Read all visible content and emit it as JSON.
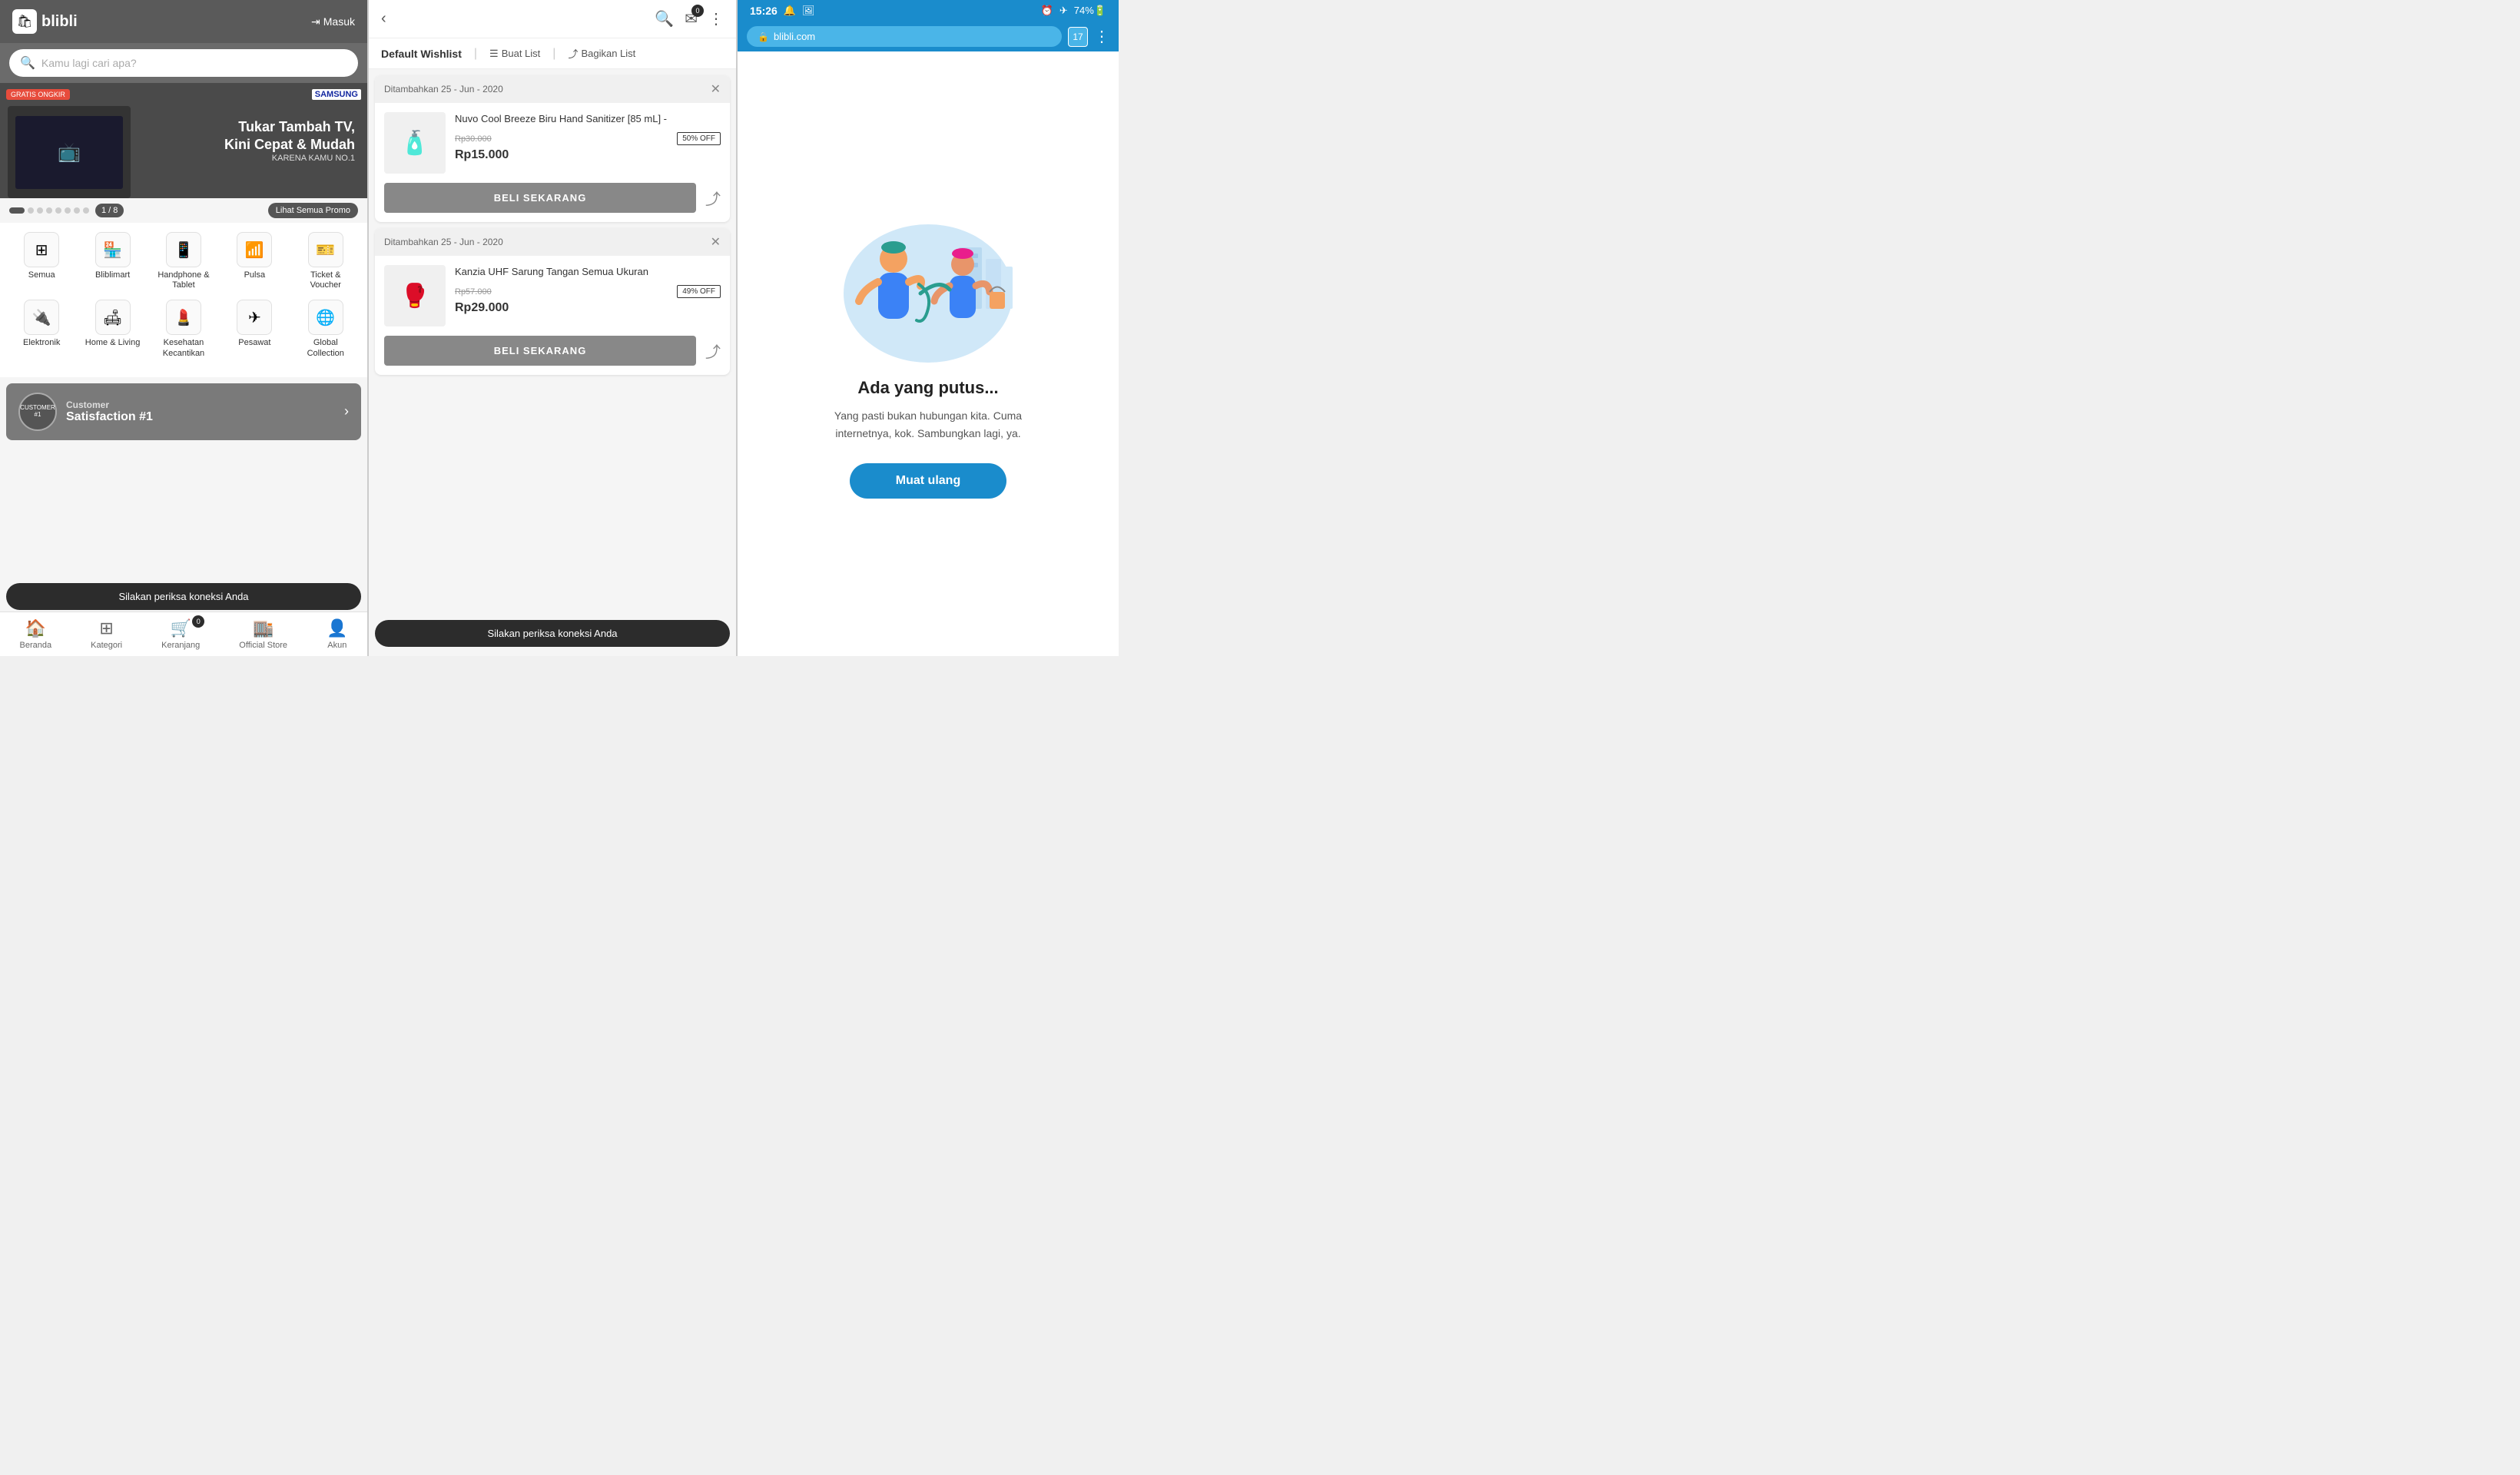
{
  "panel1": {
    "logo": "blibli",
    "logo_icon": "🛍",
    "masuk_label": "Masuk",
    "search_placeholder": "Kamu lagi cari apa?",
    "banner": {
      "gratis_label": "GRATIS ONGKIR",
      "title_line1": "Tukar Tambah TV,",
      "title_line2": "Kini Cepat & Mudah",
      "sub": "KARENA KAMU NO.1",
      "brand": "SAMSUNG"
    },
    "page_indicator": "1 / 8",
    "promo_btn": "Lihat Semua Promo",
    "categories": [
      {
        "icon": "⊞",
        "label": "Semua"
      },
      {
        "icon": "🏪",
        "label": "Bliblimart"
      },
      {
        "icon": "📱",
        "label": "Handphone & Tablet"
      },
      {
        "icon": "📶",
        "label": "Pulsa"
      },
      {
        "icon": "🎫",
        "label": "Ticket & Voucher"
      },
      {
        "icon": "🔌",
        "label": "Elektronik"
      },
      {
        "icon": "🛋",
        "label": "Home & Living"
      },
      {
        "icon": "💄",
        "label": "Kesehatan Kecantikan"
      },
      {
        "icon": "✈",
        "label": "Pesawat"
      },
      {
        "icon": "🌐",
        "label": "Global Collection"
      }
    ],
    "satisfaction": {
      "badge": "CUSTOMER SATISFACTION #1",
      "label": "Customer",
      "title": "Satisfaction #1"
    },
    "offline_msg": "Silakan periksa koneksi Anda",
    "footer": [
      {
        "icon": "🏠",
        "label": "Beranda"
      },
      {
        "icon": "⊞",
        "label": "Kategori"
      },
      {
        "icon": "🛒",
        "label": "Keranjang",
        "badge": "0"
      },
      {
        "icon": "🏬",
        "label": "Official Store"
      },
      {
        "icon": "👤",
        "label": "Akun"
      }
    ]
  },
  "panel2": {
    "back_icon": "‹",
    "search_icon": "🔍",
    "cart_icon": "✉",
    "cart_badge": "0",
    "more_icon": "⋮",
    "wishlist_title": "Default Wishlist",
    "buat_list": "Buat List",
    "bagikan_list": "Bagikan List",
    "items": [
      {
        "date": "Ditambahkan 25 - Jun - 2020",
        "name": "Nuvo Cool Breeze Biru Hand Sanitizer [85 mL] -",
        "original_price": "Rp30.000",
        "discount": "50% OFF",
        "final_price": "Rp15.000",
        "buy_label": "BELI SEKARANG",
        "icon": "🧴"
      },
      {
        "date": "Ditambahkan 25 - Jun - 2020",
        "name": "Kanzia UHF Sarung Tangan Semua Ukuran",
        "original_price": "Rp57.000",
        "discount": "49% OFF",
        "final_price": "Rp29.000",
        "buy_label": "BELI SEKARANG",
        "icon": "🥊"
      }
    ],
    "offline_msg": "Silakan periksa koneksi Anda"
  },
  "panel3": {
    "status_time": "15:26",
    "status_icons": "🔔 🖼 ✈ 74%",
    "url": "blibli.com",
    "tab_count": "17",
    "error_title": "Ada yang putus...",
    "error_desc": "Yang pasti bukan hubungan kita. Cuma internetnya, kok. Sambungkan lagi, ya.",
    "reload_label": "Muat ulang"
  }
}
